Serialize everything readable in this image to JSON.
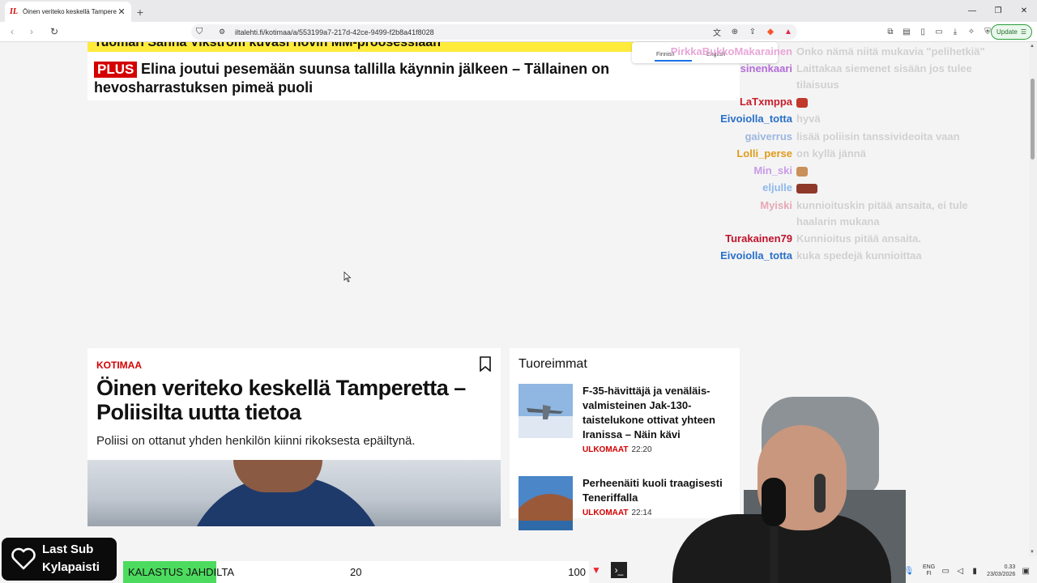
{
  "browser": {
    "tab_title": "Öinen veriteko keskellä Tampereel",
    "tab_favicon": "IL",
    "new_tab": "+",
    "url": "iltalehti.fi/kotimaa/a/553199a7-217d-42ce-9499-f2b8a41f8028",
    "update_label": "Update"
  },
  "page": {
    "top_headline_partial": "Tuomari Sanna Vikström kuvasi hovin MM-proosessiaan",
    "plus_badge": "PLUS",
    "headline1": "Elina joutui pesemään suunsa tallilla käynnin jälkeen – Tällainen on hevosharrastuksen pimeä puoli",
    "article": {
      "category": "KOTIMAA",
      "headline": "Öinen veriteko keskellä Tamperetta – Poliisilta uutta tietoa",
      "lead": "Poliisi on ottanut yhden henkilön kiinni rikoksesta epäiltynä."
    },
    "latest": {
      "title": "Tuoreimmat",
      "items": [
        {
          "text": "F-35-hävittäjä ja venäläis-valmisteinen Jak-130-taistelukone ottivat yhteen Iranissa – Näin kävi",
          "category": "ULKOMAAT",
          "time": "22:20"
        },
        {
          "text": "Perheenäiti kuoli traagisesti Teneriffalla",
          "category": "ULKOMAAT",
          "time": "22:14"
        }
      ]
    }
  },
  "translate_popup": {
    "lang_a": "Finnish",
    "lang_b": "English"
  },
  "chat": [
    {
      "user": "PirkkaBukkoMakarainen",
      "msg": "Onko nämä niitä mukavia \"pelihetkiä\"",
      "color": "#e8a6d8"
    },
    {
      "user": "sinenkaari",
      "msg": "Laittakaa siemenet sisään jos tulee tilaisuus",
      "color": "#b36bd8"
    },
    {
      "user": "LaTxmppa",
      "msg": "",
      "emote": "red",
      "color": "#c81d2b"
    },
    {
      "user": "Eivoiolla_totta",
      "msg": "hyvä",
      "color": "#2a6fc9"
    },
    {
      "user": "gaiverrus",
      "msg": "lisää poliisin tanssivideoita vaan",
      "color": "#9db7e0"
    },
    {
      "user": "Lolli_perse",
      "msg": "on kyllä jännä",
      "color": "#e09b1c"
    },
    {
      "user": "Min_ski",
      "msg": "",
      "emote": "tan",
      "color": "#c99be8"
    },
    {
      "user": "eljulle",
      "msg": "",
      "emote": "wide",
      "color": "#8fb8ea"
    },
    {
      "user": "Myiski",
      "msg": "kunnioituskin pitää ansaita, ei tule haalarin mukana",
      "color": "#e7a8b6"
    },
    {
      "user": "Turakainen79",
      "msg": "Kunnioitus pitää ansaita.",
      "color": "#c0122b"
    },
    {
      "user": "Eivoiolla_totta",
      "msg": "kuka spedejä kunnioittaa",
      "color": "#2a6fc9"
    }
  ],
  "widgets": {
    "last_sub_title": "Last Sub",
    "last_sub_name": "Kylapaisti",
    "goal_label": "KALASTUS JAHDILTA",
    "goal_current": "20",
    "goal_max": "100",
    "goal_progress": 0.2
  },
  "taskbar": {
    "lang_top": "ENG",
    "lang_bottom": "FI",
    "time": "0.33",
    "date": "23/03/2026"
  }
}
